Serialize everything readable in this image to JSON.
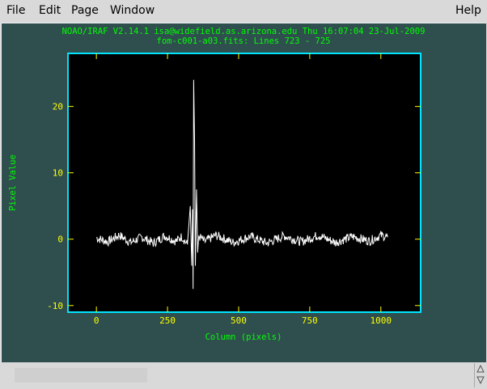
{
  "menubar": {
    "items": [
      "File",
      "Edit",
      "Page",
      "Window"
    ],
    "help": "Help"
  },
  "plot": {
    "title_line1": "NOAO/IRAF V2.14.1 isa@widefield.as.arizona.edu Thu 16:07:04 23-Jul-2009",
    "title_line2": "fom-c001-a03.fits: Lines 723 - 725",
    "xlabel": "Column (pixels)",
    "ylabel": "Pixel Value"
  },
  "colors": {
    "canvas_bg": "#2f4f4f",
    "plot_bg": "#000000",
    "frame": "#00e5ff",
    "ticks": "#ffff00",
    "labels": "#00ff00",
    "trace": "#ffffff"
  },
  "chart_data": {
    "type": "line",
    "xlim": [
      -100,
      1140
    ],
    "ylim": [
      -11,
      28
    ],
    "x_ticks": [
      0,
      250,
      500,
      750,
      1000
    ],
    "y_ticks": [
      -10,
      0,
      10,
      20
    ],
    "grid": false,
    "series": [
      {
        "x": [
          0,
          40,
          80,
          120,
          160,
          200,
          240,
          280,
          300,
          320,
          330,
          335,
          338,
          340,
          342,
          345,
          348,
          352,
          356,
          360,
          380,
          420,
          480,
          540,
          600,
          660,
          720,
          780,
          840,
          900,
          960,
          1000,
          1024
        ],
        "y": [
          0.2,
          -0.4,
          0.6,
          -0.5,
          0.3,
          -0.6,
          0.5,
          -0.3,
          0.4,
          -0.8,
          5.0,
          -4.0,
          4.5,
          -7.5,
          24.0,
          15.0,
          -4.0,
          7.5,
          -2.0,
          0.5,
          -0.4,
          0.6,
          -0.5,
          0.4,
          -0.6,
          0.5,
          -0.4,
          0.6,
          -0.5,
          0.4,
          -0.3,
          0.6,
          0.3
        ]
      }
    ]
  }
}
